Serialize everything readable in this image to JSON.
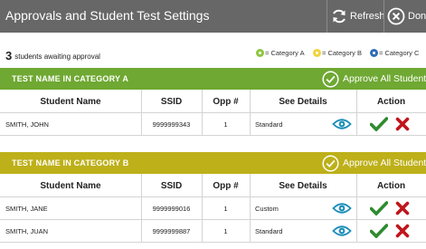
{
  "window": {
    "title": "Approvals and Student Test Settings",
    "refresh_label": "Refresh",
    "done_label": "Done"
  },
  "summary": {
    "count": "3",
    "text": "students awaiting approval"
  },
  "legend": [
    {
      "label": "= Category A",
      "color": "#8dc63f"
    },
    {
      "label": "= Category B",
      "color": "#f2d33a"
    },
    {
      "label": "= Category C",
      "color": "#2f6db5"
    }
  ],
  "columns": {
    "student_name": "Student Name",
    "ssid": "SSID",
    "opp": "Opp #",
    "see_details": "See Details",
    "action": "Action"
  },
  "sections": [
    {
      "title": "TEST NAME IN CATEGORY A",
      "approve_all": "Approve All Students",
      "color": "#6fa832",
      "rows": [
        {
          "name": "SMITH, JOHN",
          "ssid": "9999999343",
          "opp": "1",
          "details": "Standard"
        }
      ]
    },
    {
      "title": "TEST NAME IN CATEGORY B",
      "approve_all": "Approve All Students",
      "color": "#bdb019",
      "rows": [
        {
          "name": "SMITH, JANE",
          "ssid": "9999999016",
          "opp": "1",
          "details": "Custom"
        },
        {
          "name": "SMITH, JUAN",
          "ssid": "9999999887",
          "opp": "1",
          "details": "Standard"
        }
      ]
    }
  ],
  "colors": {
    "titlebar": "#676767",
    "eye": "#1a8db8",
    "approve": "#2e8b2e",
    "deny": "#c0151b"
  }
}
